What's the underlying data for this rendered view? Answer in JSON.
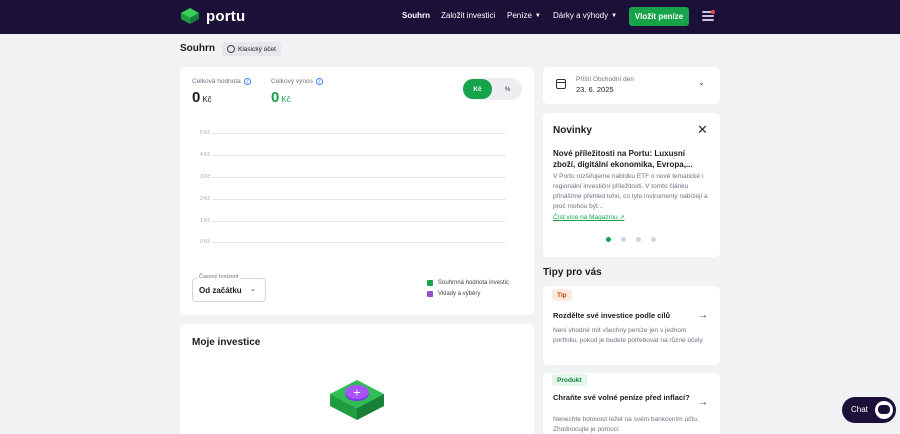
{
  "nav": {
    "logo": "portu",
    "items": [
      {
        "label": "Souhrn"
      },
      {
        "label": "Založit investici"
      },
      {
        "label": "Peníze"
      },
      {
        "label": "Dárky a výhody"
      }
    ],
    "cta": "Vložit peníze"
  },
  "page": {
    "title": "Souhrn",
    "account_label": "Klasický účet"
  },
  "summary": {
    "total_value_label": "Celková hodnota",
    "total_value": "0",
    "total_yield_label": "Celkový výnos",
    "total_yield": "0",
    "currency": "Kč",
    "toggle_currency": "Kč",
    "toggle_percent": "%"
  },
  "chart": {
    "y_ticks": [
      "5 Kč",
      "4 Kč",
      "3 Kč",
      "2 Kč",
      "1 Kč",
      "0 Kč"
    ],
    "horizon_label": "Časový horizont",
    "horizon_value": "Od začátku",
    "legend": [
      {
        "name": "Souhrnná hodnota investic",
        "color": "#16a34a"
      },
      {
        "name": "Vklady a výběry",
        "color": "#9b4dca"
      }
    ]
  },
  "chart_data": {
    "type": "line",
    "y_tick_labels": [
      "5 Kč",
      "4 Kč",
      "3 Kč",
      "2 Kč",
      "1 Kč",
      "0 Kč"
    ],
    "ylim": [
      0,
      5
    ],
    "series": [
      {
        "name": "Souhrnná hodnota investic",
        "values": []
      },
      {
        "name": "Vklady a výběry",
        "values": []
      }
    ],
    "grid": true,
    "legend_position": "bottom-right"
  },
  "investments": {
    "title": "Moje investice"
  },
  "trading_day": {
    "label": "Příští Obchodní den",
    "date": "23. 6. 2025"
  },
  "news": {
    "title": "Novinky",
    "headline": "Nové příležitosti na Portu: Luxusní zboží, digitální ekonomika, Evropa,...",
    "body": "V Portu rozšiřujeme nabídku ETF o nové tematické i regionální investiční příležitosti. V tomto článku přinášíme přehled toho, co tyto instrumenty nabízejí a proč mohou být...",
    "link": "Číst více na Magazínu"
  },
  "tips": {
    "title": "Tipy pro vás",
    "items": [
      {
        "tag": "Tip",
        "title": "Rozdělte své investice podle cílů",
        "body": "Není vhodné mít všechny peníze jen v jednom portfoliu, pokud je budete potřebovat na různé účely."
      },
      {
        "tag": "Produkt",
        "title": "Chraňte své volné peníze před inflací?",
        "body": "Nenechte hotovost ležet na svém bankovním účtu. Zhodnocujte je pomocí"
      }
    ]
  },
  "chat": {
    "label": "Chat"
  },
  "colors": {
    "brand_dark": "#1b1138",
    "accent_green": "#16a34a",
    "accent_purple": "#9b4dca",
    "tip_tag_bg": "#fdecde",
    "tip_tag_fg": "#c2410c",
    "product_tag_bg": "#e3f6e8",
    "product_tag_fg": "#15803d"
  }
}
